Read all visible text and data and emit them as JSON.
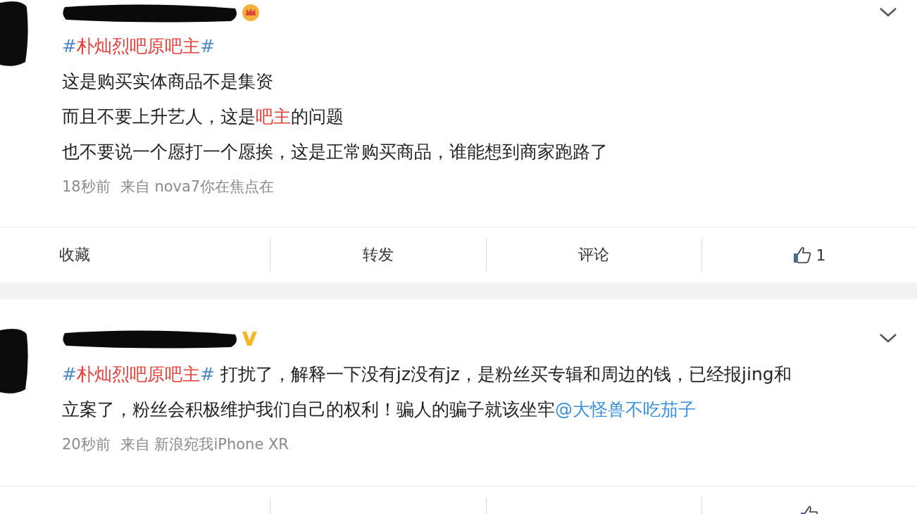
{
  "posts": [
    {
      "badge": {
        "kind": "crown"
      },
      "lines": [
        [
          {
            "kind": "hash",
            "text": "#"
          },
          {
            "kind": "topic",
            "text": "朴灿烈吧原吧主"
          },
          {
            "kind": "hash",
            "text": "#"
          }
        ],
        [
          {
            "kind": "text",
            "text": "这是购买实体商品不是集资"
          }
        ],
        [
          {
            "kind": "text",
            "text": "而且不要上升艺人，这是"
          },
          {
            "kind": "topic",
            "text": "吧主"
          },
          {
            "kind": "text",
            "text": "的问题"
          }
        ],
        [
          {
            "kind": "text",
            "text": "也不要说一个愿打一个愿挨，这是正常购买商品，谁能想到商家跑路了"
          }
        ]
      ],
      "time": "18秒前",
      "source": "来自 nova7你在焦点在",
      "actions": [
        {
          "kind": "favorite",
          "label": "收藏"
        },
        {
          "kind": "repost",
          "label": "转发"
        },
        {
          "kind": "comment",
          "label": "评论"
        },
        {
          "kind": "like",
          "label": "1"
        }
      ]
    },
    {
      "badge": {
        "kind": "verified"
      },
      "lines": [
        [
          {
            "kind": "hash",
            "text": "#"
          },
          {
            "kind": "topic",
            "text": "朴灿烈吧原吧主"
          },
          {
            "kind": "hash",
            "text": "#"
          },
          {
            "kind": "text",
            "text": " 打扰了，解释一下没有jz没有jz，是粉丝买专辑和周边的钱，已经报jing和"
          }
        ],
        [
          {
            "kind": "text",
            "text": "立案了，粉丝会积极维护我们自己的权利！骗人的骗子就该坐牢"
          },
          {
            "kind": "mention",
            "text": "@大怪兽不吃茄子"
          }
        ]
      ],
      "time": "20秒前",
      "source": "来自 新浪宛我iPhone XR",
      "actions": [
        {
          "kind": "favorite"
        },
        {
          "kind": "repost"
        },
        {
          "kind": "comment"
        },
        {
          "kind": "like"
        }
      ]
    }
  ]
}
